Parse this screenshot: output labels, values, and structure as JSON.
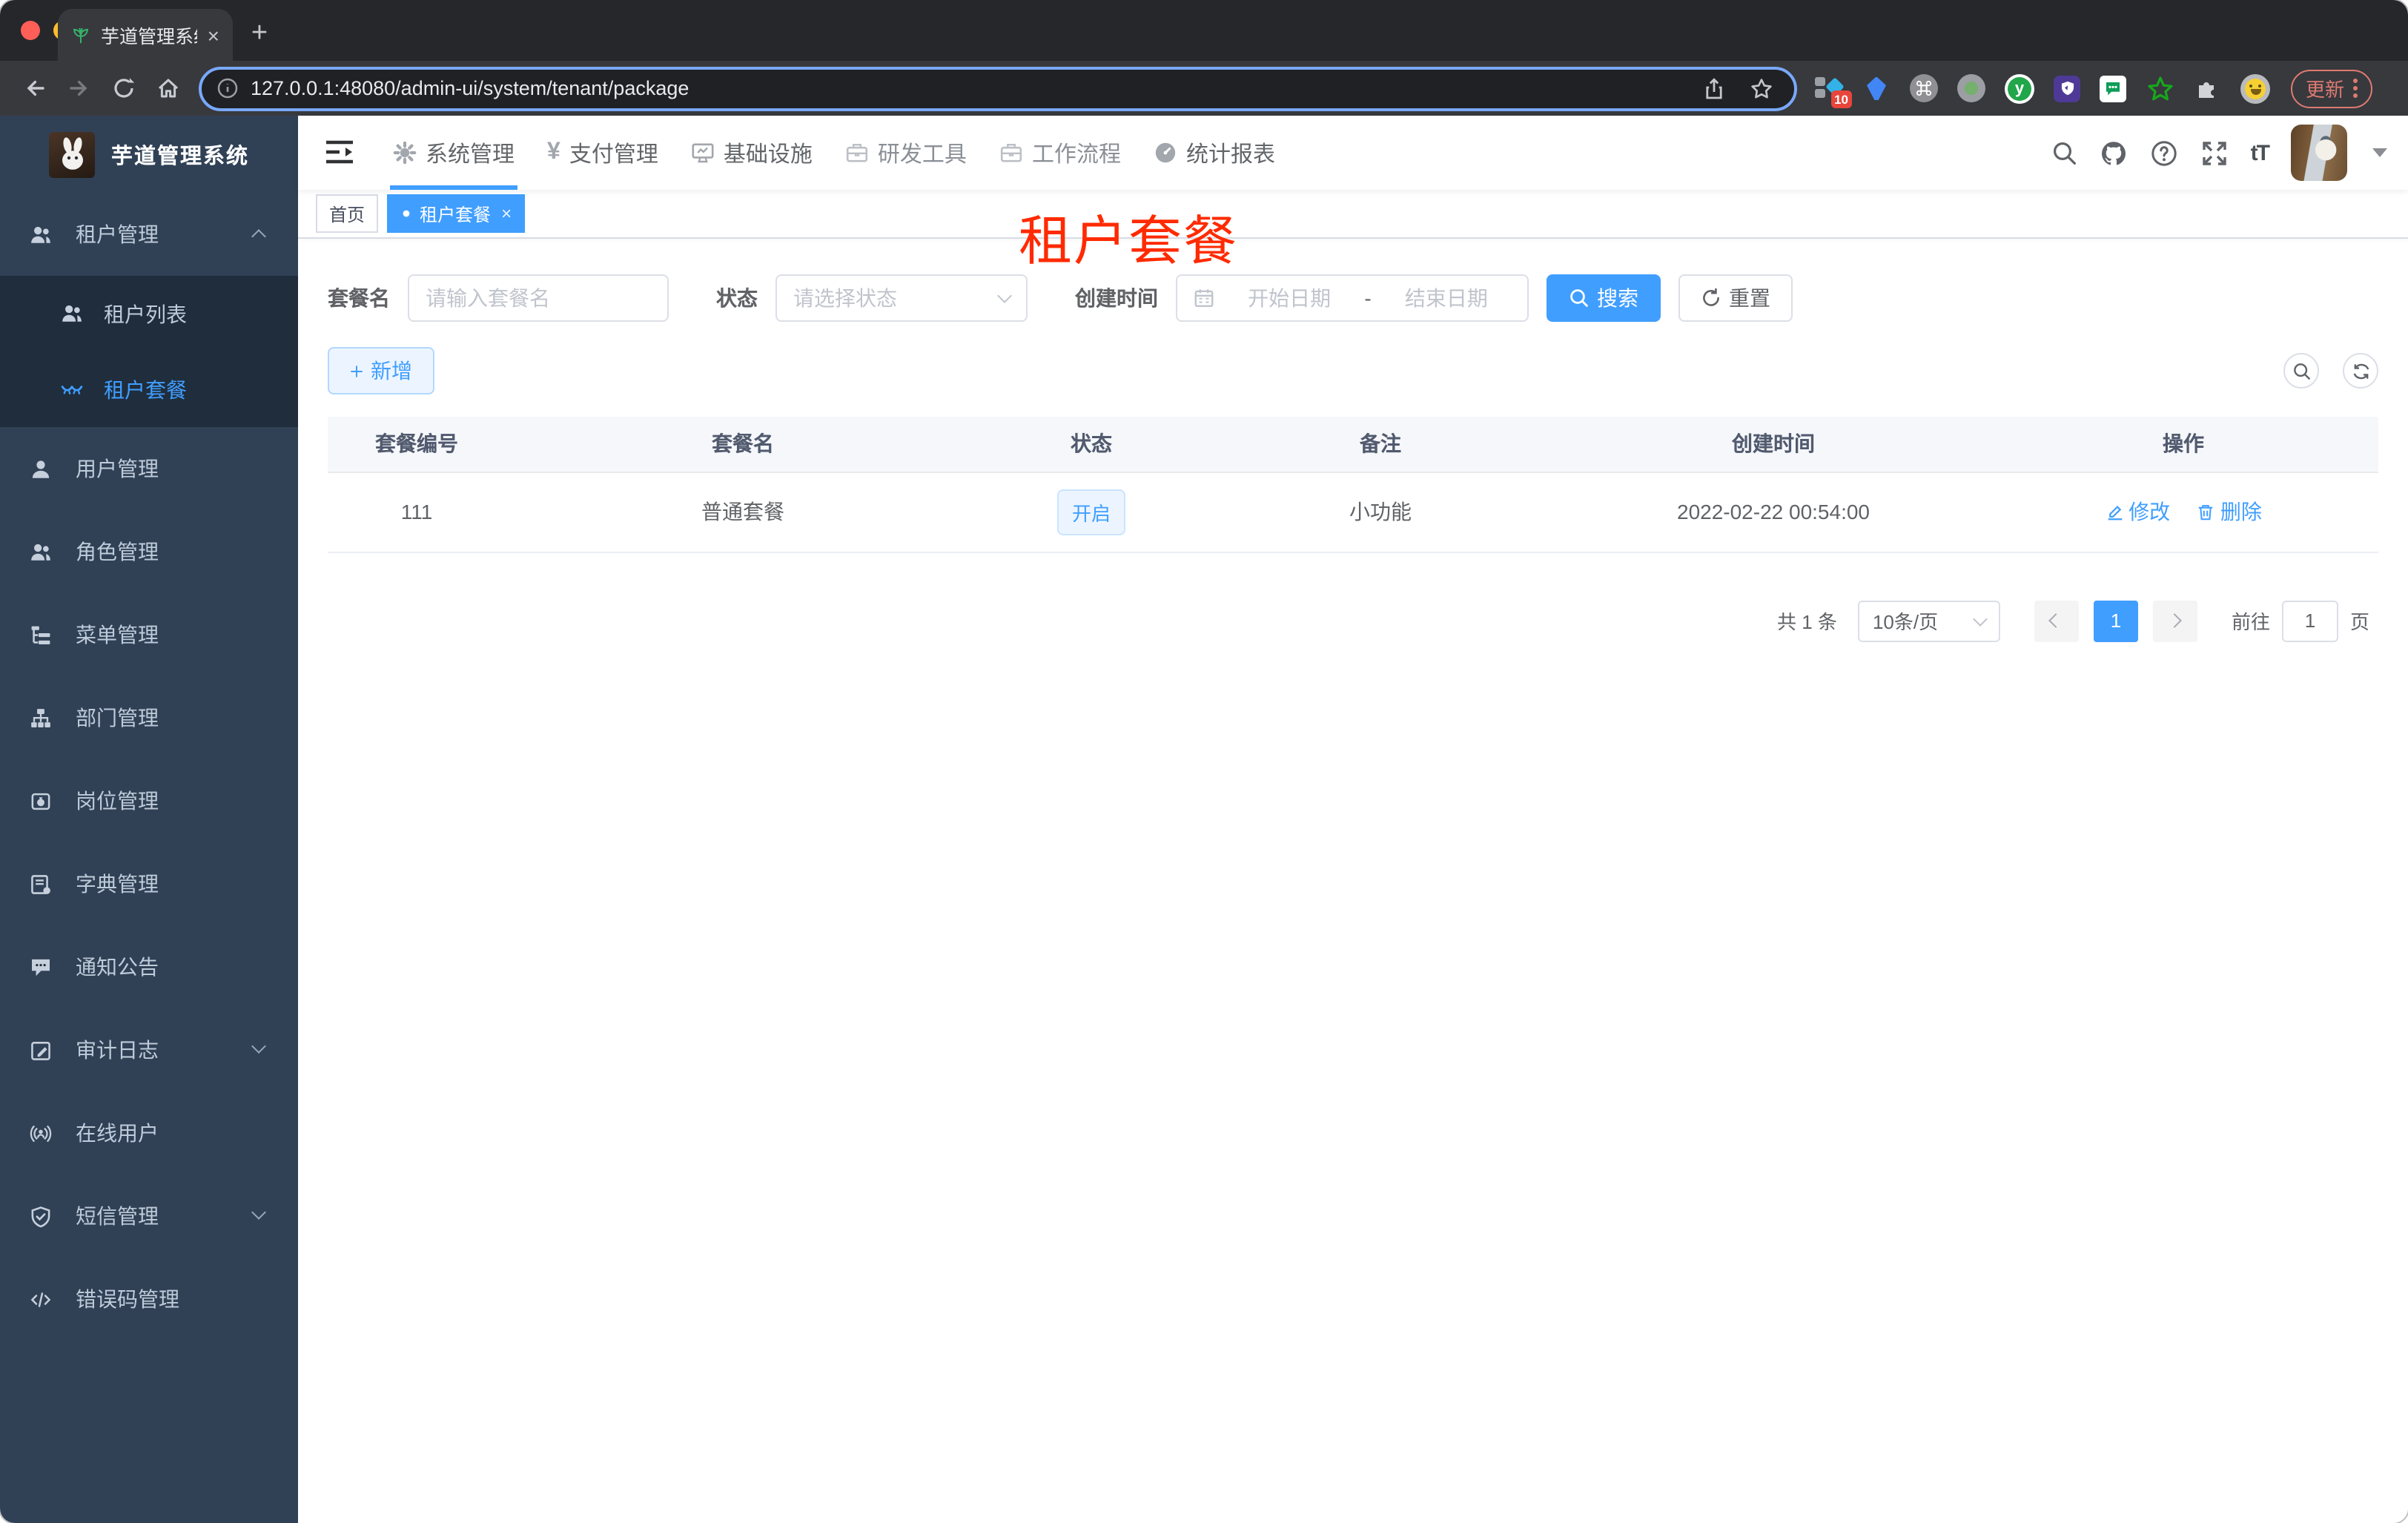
{
  "browser": {
    "tab_title": "芋道管理系统",
    "tab_close": "×",
    "new_tab": "+",
    "url": "127.0.0.1:48080/admin-ui/system/tenant/package",
    "extension_badge": "10",
    "ext_y_letter": "y",
    "update_label": "更新"
  },
  "app": {
    "logo_title": "芋道管理系统",
    "nav": {
      "items": [
        {
          "label": "系统管理"
        },
        {
          "label": "支付管理"
        },
        {
          "label": "基础设施"
        },
        {
          "label": "研发工具"
        },
        {
          "label": "工作流程"
        },
        {
          "label": "统计报表"
        }
      ],
      "yen_glyph": "¥",
      "text_size_glyph": "tT"
    },
    "sidebar": {
      "items": [
        {
          "label": "租户管理"
        },
        {
          "label": "租户列表"
        },
        {
          "label": "租户套餐"
        },
        {
          "label": "用户管理"
        },
        {
          "label": "角色管理"
        },
        {
          "label": "菜单管理"
        },
        {
          "label": "部门管理"
        },
        {
          "label": "岗位管理"
        },
        {
          "label": "字典管理"
        },
        {
          "label": "通知公告"
        },
        {
          "label": "审计日志"
        },
        {
          "label": "在线用户"
        },
        {
          "label": "短信管理"
        },
        {
          "label": "错误码管理"
        }
      ]
    },
    "tags": [
      {
        "label": "首页"
      },
      {
        "label": "租户套餐",
        "close": "×"
      }
    ],
    "overlay_title": "租户套餐",
    "filters": {
      "name_label": "套餐名",
      "name_placeholder": "请输入套餐名",
      "status_label": "状态",
      "status_placeholder": "请选择状态",
      "time_label": "创建时间",
      "start_placeholder": "开始日期",
      "range_separator": "-",
      "end_placeholder": "结束日期",
      "search_label": "搜索",
      "reset_label": "重置"
    },
    "toolbar": {
      "add_label": "新增"
    },
    "table": {
      "columns": [
        "套餐编号",
        "套餐名",
        "状态",
        "备注",
        "创建时间",
        "操作"
      ],
      "rows": [
        {
          "id": "111",
          "name": "普通套餐",
          "status": "开启",
          "remark": "小功能",
          "create_time": "2022-02-22 00:54:00",
          "edit_label": "修改",
          "delete_label": "删除"
        }
      ]
    },
    "pagination": {
      "total": "共 1 条",
      "page_size": "10条/页",
      "current_page": "1",
      "goto_label": "前往",
      "goto_value": "1",
      "page_suffix": "页"
    }
  },
  "colors": {
    "primary": "#409eff",
    "sidebar_bg": "#304156",
    "submenu_bg": "#1f2d3d",
    "overlay_red": "#ff2a00",
    "tag_active_bg": "#409eff"
  }
}
